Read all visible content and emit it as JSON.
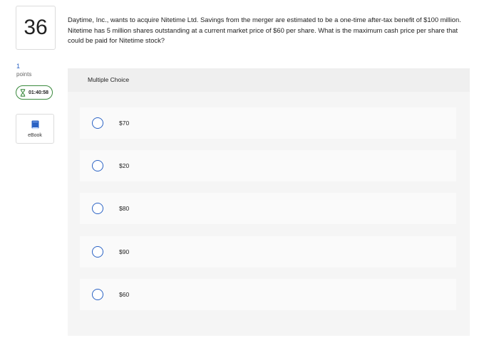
{
  "question": {
    "number": "36",
    "points_value": "1",
    "points_label": "points",
    "text": "Daytime, Inc., wants to acquire Nitetime Ltd. Savings from the merger are estimated to be a one-time after-tax benefit of $100 million. Nitetime has 5 million shares outstanding at a current market price of $60 per share. What is the maximum cash price per share that could be paid for Nitetime stock?"
  },
  "timer": {
    "time": "01:40:58",
    "icon": "hourglass-icon",
    "color": "#3b8a3e"
  },
  "ebook": {
    "label": "eBook",
    "icon": "book-icon",
    "color": "#2a62c4"
  },
  "multiple_choice": {
    "title": "Multiple Choice",
    "options": [
      "$70",
      "$20",
      "$80",
      "$90",
      "$60"
    ]
  },
  "colors": {
    "accent": "#2a62c4",
    "panel_bg": "#f5f5f5",
    "option_bg": "#fafafa"
  }
}
